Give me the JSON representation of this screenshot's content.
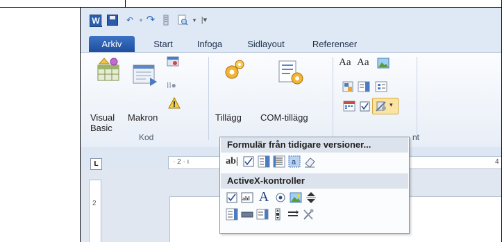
{
  "colors": {
    "accent": "#2b5aa8",
    "ribbon_bg": "#e8eef7",
    "popup_header": "#dde3ec"
  },
  "qat": {
    "app_icon": "W",
    "icons": [
      "word-icon",
      "save-icon",
      "undo-icon",
      "redo-icon",
      "customize-icon",
      "print-preview-icon",
      "dropdown-icon"
    ]
  },
  "tabs": [
    "Arkiv",
    "Start",
    "Infoga",
    "Sidlayout",
    "Referenser"
  ],
  "ribbon": {
    "visual_basic": "Visual\nBasic",
    "macros": "Makron",
    "addins": "Tillägg",
    "com_addins": "COM-tillägg",
    "group_code": "Kod",
    "group_controls_partial": "nt"
  },
  "ruler": {
    "tab_selector": "L",
    "horizontal_marks": "· 2 · ı",
    "right_mark": "4",
    "vertical_mark": "2"
  },
  "popup": {
    "legacy_header": "Formulär från tidigare versioner...",
    "activex_header": "ActiveX-kontroller",
    "legacy_controls": [
      "text-field-icon",
      "checkbox-icon",
      "combo-box-icon",
      "frame-icon",
      "shading-icon",
      "eraser-icon"
    ],
    "legacy_text_field_glyph": "ab|",
    "activex_row1": [
      "checkbox-icon",
      "textbox-icon",
      "label-icon",
      "option-button-icon",
      "image-icon",
      "spin-button-icon"
    ],
    "activex_row2": [
      "list-box-icon",
      "command-button-icon",
      "combo-box-icon",
      "scroll-bar-icon",
      "toggle-button-icon",
      "more-controls-icon"
    ],
    "label_glyph": "A"
  }
}
